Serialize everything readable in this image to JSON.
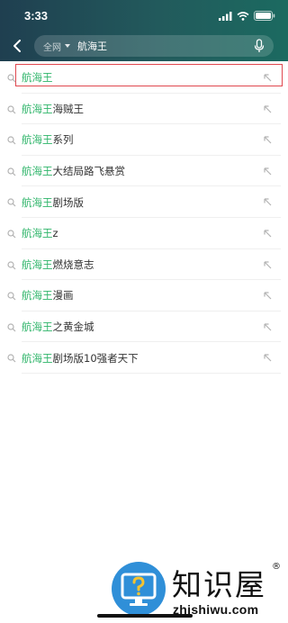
{
  "status_bar": {
    "time": "3:33"
  },
  "header": {
    "scope_label": "全网",
    "query": "航海王"
  },
  "suggestions": [
    {
      "highlight": "航海王",
      "rest": ""
    },
    {
      "highlight": "航海王",
      "rest": "海贼王"
    },
    {
      "highlight": "航海王",
      "rest": "系列"
    },
    {
      "highlight": "航海王",
      "rest": "大结局路飞悬赏"
    },
    {
      "highlight": "航海王",
      "rest": "剧场版"
    },
    {
      "highlight": "航海王",
      "rest": "z"
    },
    {
      "highlight": "航海王",
      "rest": "燃烧意志"
    },
    {
      "highlight": "航海王",
      "rest": "漫画"
    },
    {
      "highlight": "航海王",
      "rest": "之黄金城"
    },
    {
      "highlight": "航海王",
      "rest": "剧场版10强者天下"
    }
  ],
  "watermark": {
    "title": "知识屋",
    "reg": "®",
    "url": "zhishiwu.com"
  },
  "colors": {
    "header_start": "#1f3f50",
    "header_end": "#1b6a60",
    "highlight": "#2fb56a",
    "selection_border": "#e0484f"
  },
  "icons": {
    "back": "chevron-left-icon",
    "mic": "microphone-icon",
    "search": "search-icon",
    "fill": "arrow-up-left-icon"
  }
}
